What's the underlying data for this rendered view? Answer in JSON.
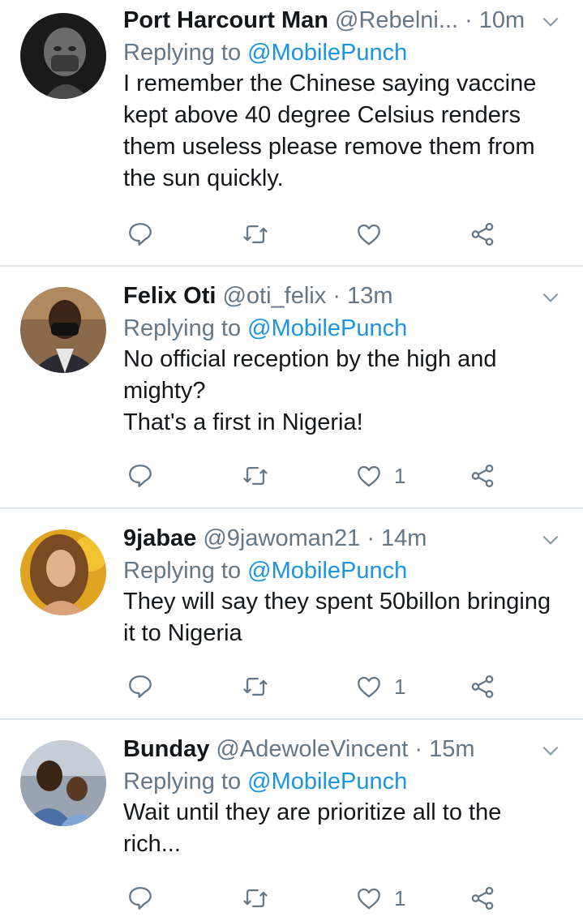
{
  "colors": {
    "text": "#14171a",
    "secondary": "#657786",
    "link": "#1b95e0",
    "divider": "#e1e8ed"
  },
  "tweets": [
    {
      "name": "Port Harcourt Man",
      "handle": "@Rebelni...",
      "separator": "·",
      "time": "10m",
      "replying_label": "Replying to",
      "replying_to": "@MobilePunch",
      "text": "I remember the Chinese saying vaccine\nkept above 40 degree Celsius renders\nthem useless please remove them from\nthe sun quickly.",
      "likes": ""
    },
    {
      "name": "Felix Oti",
      "handle": "@oti_felix",
      "separator": "·",
      "time": "13m",
      "replying_label": "Replying to",
      "replying_to": "@MobilePunch",
      "text": "No official reception by the high and\nmighty?\nThat's a first in Nigeria!",
      "likes": "1"
    },
    {
      "name": "9jabae",
      "handle": "@9jawoman21",
      "separator": "·",
      "time": "14m",
      "replying_label": "Replying to",
      "replying_to": "@MobilePunch",
      "text": "They will say they spent 50billon bringing\nit to Nigeria",
      "likes": "1"
    },
    {
      "name": "Bunday",
      "handle": "@AdewoleVincent",
      "separator": "·",
      "time": "15m",
      "replying_label": "Replying to",
      "replying_to": "@MobilePunch",
      "text": "Wait until they are prioritize all to the\nrich...",
      "likes": "1"
    }
  ]
}
